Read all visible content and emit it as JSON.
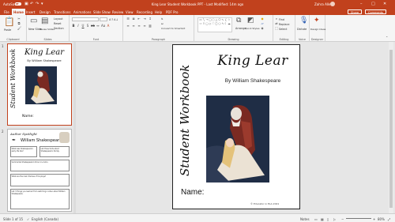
{
  "titlebar": {
    "autosave": "AutoSave",
    "autosave_state": "Off",
    "doc_title": "King Lear Student Workbook PPT - Last Modified: 14m ago",
    "user": "Zahra Allen",
    "minimize": "–",
    "maximize": "□",
    "close": "✕"
  },
  "menu": {
    "tabs": [
      "File",
      "Home",
      "Insert",
      "Design",
      "Transitions",
      "Animations",
      "Slide Show",
      "Review",
      "View",
      "Recording",
      "Help",
      "PDF Pro"
    ],
    "active_tab": "Home",
    "share": "Share",
    "comments": "Comments"
  },
  "ribbon": {
    "groups": {
      "clipboard": "Clipboard",
      "slides": "Slides",
      "font": "Font",
      "paragraph": "Paragraph",
      "drawing": "Drawing",
      "editing": "Editing",
      "voice": "Voice",
      "designer": "Designer"
    },
    "paste": "Paste",
    "new_slide": "New Slide",
    "reuse_slides": "Reuse Slides",
    "layout": "Layout",
    "reset": "Reset",
    "section": "Section",
    "font_name": "",
    "font_size": "",
    "convert_smartart": "Convert to SmartArt",
    "arrange": "Arrange",
    "quick_styles": "Quick Styles",
    "find": "Find",
    "replace": "Replace",
    "select": "Select",
    "dictate": "Dictate",
    "design_ideas": "Design Ideas"
  },
  "thumbnails": [
    {
      "number": "1",
      "title": "King Lear",
      "byline": "By William Shakespeare",
      "vertical": "Student Workbook",
      "name_label": "Name:"
    },
    {
      "number": "2",
      "heading": "Author Spotlight",
      "author": "William Shakespeare",
      "q1": "What was Shakespeare's early life like?",
      "q2": "List three facts about Shakespeare's family.",
      "q3": "Summarize Shakespeare's time in London.",
      "q4": "What are the main themes of his plays?",
      "q5": "List 3 things you learned from watching a video about William Shakespeare."
    }
  ],
  "slide": {
    "title": "King Lear",
    "byline": "By William Shakespeare",
    "vertical": "Student Workbook",
    "name_label": "Name:",
    "copyright": "© Educator in ELA 2021"
  },
  "statusbar": {
    "slide_info": "Slide 1 of 15",
    "language": "English (Canada)",
    "notes": "Notes",
    "zoom": "80%"
  },
  "colors": {
    "accent": "#c1411d",
    "slide_image_bg": "#1f2d45",
    "robe_red": "#7a2a22",
    "dress_cream": "#ebe2d4"
  }
}
